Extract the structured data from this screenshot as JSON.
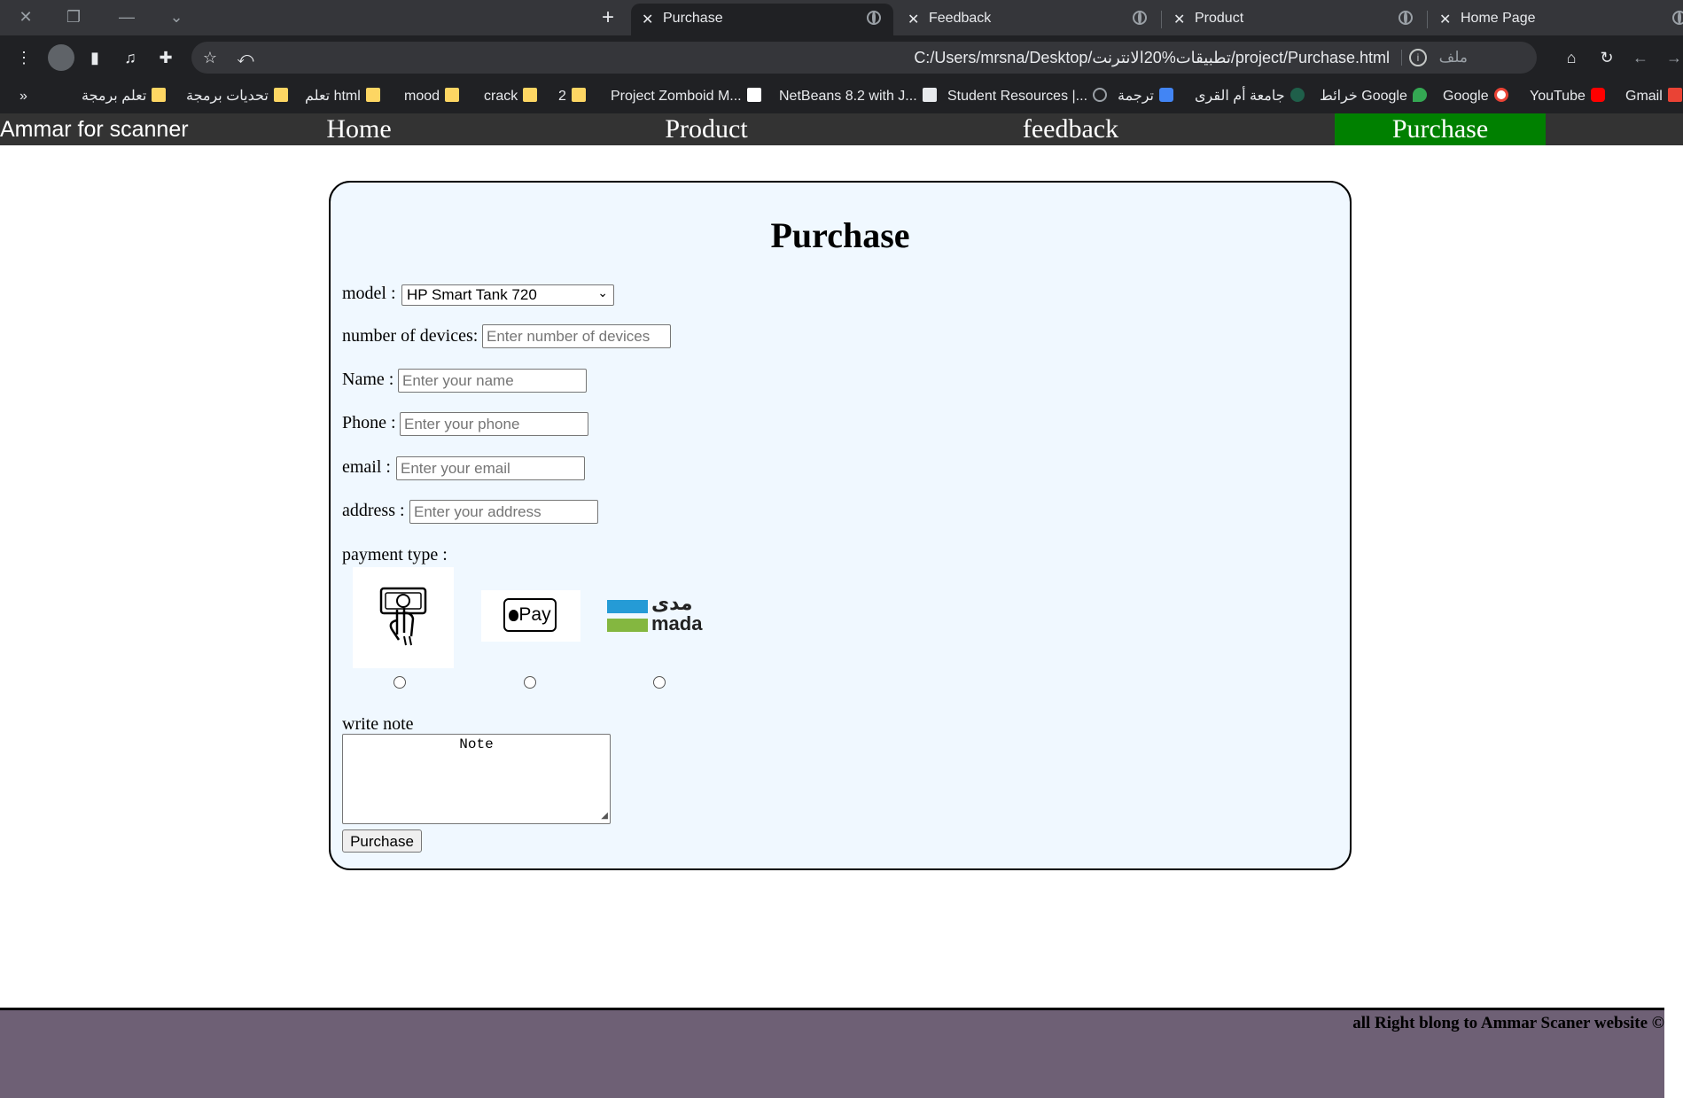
{
  "browser": {
    "tabs": [
      {
        "title": "Purchase",
        "active": true
      },
      {
        "title": "Feedback",
        "active": false
      },
      {
        "title": "Product",
        "active": false
      },
      {
        "title": "Home Page",
        "active": false
      }
    ],
    "url": "C:/Users/mrsna/Desktop/تطبيقات%20الانترنت/project/Purchase.html",
    "url_scheme_label": "ملف",
    "bookmarks": [
      {
        "label": "Gmail",
        "icon": "gmail-icon"
      },
      {
        "label": "YouTube",
        "icon": "youtube-icon"
      },
      {
        "label": "Google",
        "icon": "google-icon"
      },
      {
        "label": "خرائط Google",
        "icon": "maps-icon"
      },
      {
        "label": "جامعة أم القرى",
        "icon": "university-icon"
      },
      {
        "label": "ترجمة",
        "icon": "translate-icon"
      },
      {
        "label": "Student Resources |...",
        "icon": "globe-icon"
      },
      {
        "label": "NetBeans 8.2 with J...",
        "icon": "netbeans-icon"
      },
      {
        "label": "Project Zomboid M...",
        "icon": "page-icon"
      },
      {
        "label": "2",
        "icon": "folder-icon"
      },
      {
        "label": "crack",
        "icon": "folder-icon"
      },
      {
        "label": "mood",
        "icon": "folder-icon"
      },
      {
        "label": "تعلم html",
        "icon": "folder-icon"
      },
      {
        "label": "تحديات برمجة",
        "icon": "folder-icon"
      },
      {
        "label": "تعلم برمجة",
        "icon": "folder-icon"
      }
    ],
    "more_bookmarks": "»"
  },
  "nav": {
    "brand": "Ammar for scanner",
    "links": [
      {
        "label": "Home",
        "active": false
      },
      {
        "label": "Product",
        "active": false
      },
      {
        "label": "feedback",
        "active": false
      },
      {
        "label": "Purchase",
        "active": true
      }
    ],
    "active_color": "#008000"
  },
  "form": {
    "title": "Purchase",
    "model_label": "model :",
    "model_value": "HP Smart Tank 720",
    "devices_label": "number of devices:",
    "devices_placeholder": "Enter number of devices",
    "name_label": "Name :",
    "name_placeholder": "Enter your name",
    "phone_label": "Phone :",
    "phone_placeholder": "Enter your phone",
    "email_label": "email :",
    "email_placeholder": "Enter your email",
    "address_label": "address :",
    "address_placeholder": "Enter your address",
    "payment_label": "payment type :",
    "payment_options": [
      {
        "icon": "cash-hand-icon"
      },
      {
        "icon": "apple-pay-icon",
        "text": "Pay"
      },
      {
        "icon": "mada-icon",
        "text_ar": "مدى",
        "text_en": "mada"
      }
    ],
    "note_label": "write note",
    "note_value": "Note",
    "submit_label": "Purchase"
  },
  "footer": {
    "text": "all Right blong to Ammar Scaner website ©",
    "background": "#6e6075"
  }
}
